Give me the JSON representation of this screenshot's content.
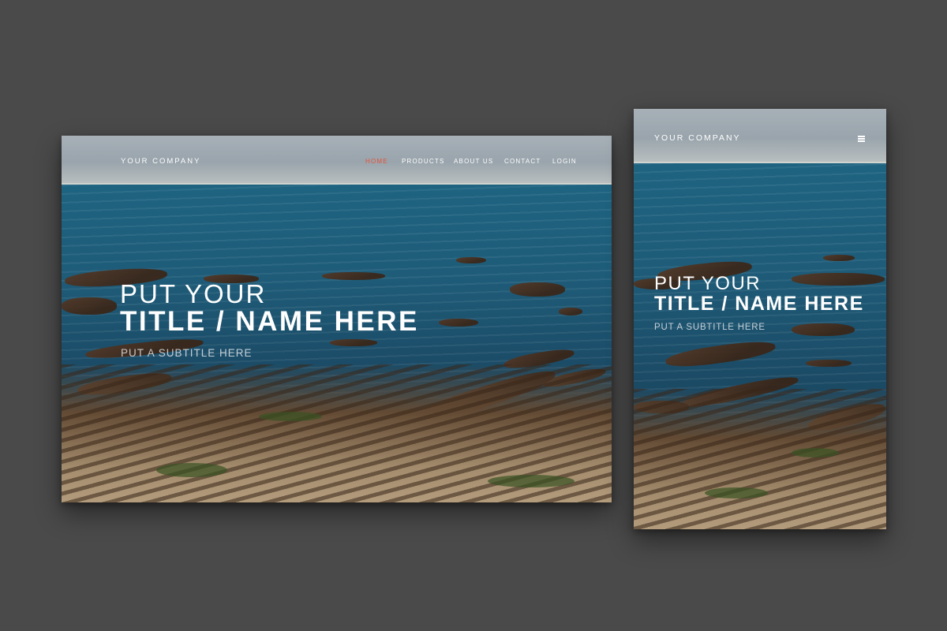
{
  "desktop": {
    "brand": "YOUR COMPANY",
    "nav": [
      {
        "label": "HOME",
        "active": true
      },
      {
        "label": "PRODUCTS",
        "active": false
      },
      {
        "label": "ABOUT US",
        "active": false
      },
      {
        "label": "CONTACT",
        "active": false
      },
      {
        "label": "LOGIN",
        "active": false
      }
    ],
    "hero": {
      "title_line1": "PUT YOUR",
      "title_line2": "TITLE / NAME HERE",
      "subtitle": "PUT A SUBTITLE HERE"
    }
  },
  "mobile": {
    "brand": "YOUR COMPANY",
    "menu_icon": "hamburger-menu-icon",
    "hero": {
      "title_line1": "PUT YOUR",
      "title_line2": "TITLE / NAME HERE",
      "subtitle": "PUT A SUBTITLE HERE"
    }
  },
  "colors": {
    "background": "#4a4a4a",
    "active_nav": "#e8533a",
    "text": "#ffffff"
  }
}
